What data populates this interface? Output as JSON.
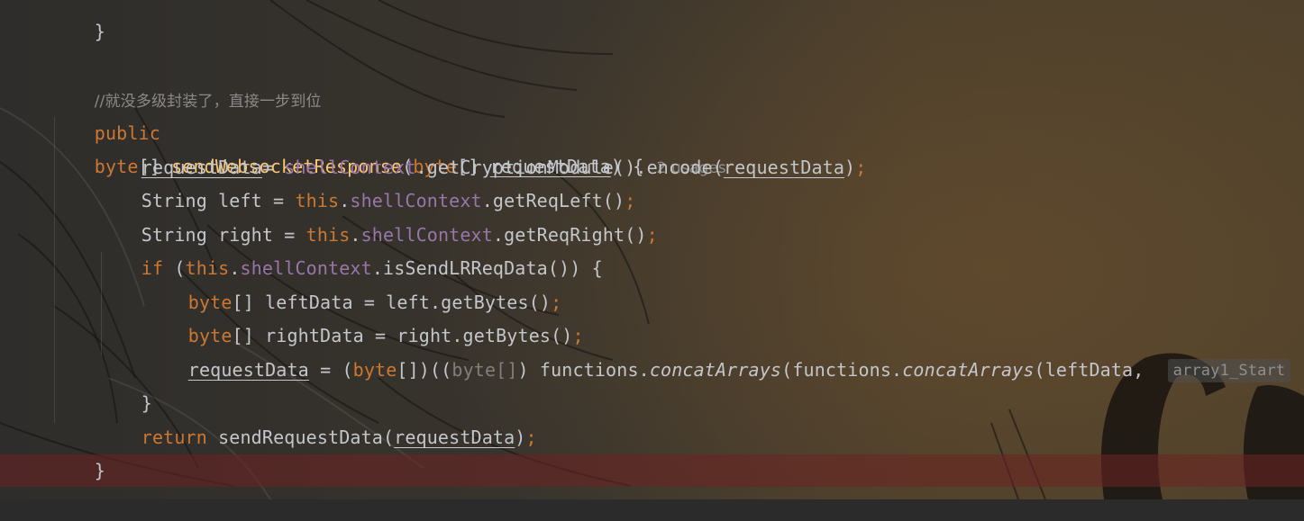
{
  "editor": {
    "top_brace": "}",
    "comment": "//就没多级封装了，直接一步到位",
    "sig": {
      "kw_public": "public",
      "kw_byte": "byte",
      "brackets": "[] ",
      "method": "sendWebsocketResponse",
      "paren_open": "(",
      "param_type": "byte",
      "param_brackets": "[] ",
      "param_name": "requestData",
      "paren_close": ") {",
      "usages_hint": "2 usages"
    },
    "l1": {
      "var": "requestData",
      "eq": "= ",
      "field": "shellContext",
      "rest": ".getCryptionModule().encode(",
      "arg": "requestData",
      "close": ")",
      "semi": ";"
    },
    "l2": {
      "decl": "String left = ",
      "kw_this": "this",
      "dot": ".",
      "field": "shellContext",
      "rest": ".getReqLeft()",
      "semi": ";"
    },
    "l3": {
      "decl": "String right = ",
      "kw_this": "this",
      "dot": ".",
      "field": "shellContext",
      "rest": ".getReqRight()",
      "semi": ";"
    },
    "l4": {
      "kw_if": "if",
      "open": " (",
      "kw_this": "this",
      "dot": ".",
      "field": "shellContext",
      "rest": ".isSendLRReqData()) {"
    },
    "l5": {
      "kw_byte": "byte",
      "rest": "[] leftData = left.getBytes()",
      "semi": ";"
    },
    "l6": {
      "kw_byte": "byte",
      "rest": "[] rightData = right.getBytes()",
      "semi": ";"
    },
    "l7": {
      "var": "requestData",
      "eq": " = (",
      "kw_byte": "byte",
      "cast_close": "[])((",
      "dim_cast": "byte[]",
      "rest1": ") functions.",
      "call1": "concatArrays",
      "rest2": "(functions.",
      "call2": "concatArrays",
      "rest3": "(leftData, ",
      "inlay_hint": "array1_Start"
    },
    "l8": {
      "close": "}"
    },
    "l9": {
      "kw_return": "return",
      "rest": " sendRequestData(",
      "arg": "requestData",
      "close": ")",
      "semi": ";"
    },
    "l10": {
      "close": "}"
    }
  },
  "colors": {
    "keyword": "#cc7832",
    "method": "#ffc66d",
    "field": "#9876aa",
    "text": "#c3c6cb",
    "comment": "#8a8a8a",
    "error_line": "#6e2323"
  }
}
